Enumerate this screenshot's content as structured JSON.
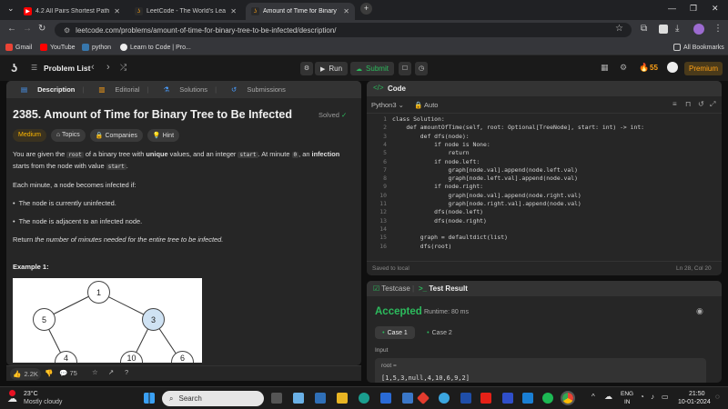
{
  "browser": {
    "tabs": [
      {
        "title": "4.2 All Pairs Shortest Path (Floy",
        "color": "#ff0000"
      },
      {
        "title": "LeetCode - The World's Leading",
        "color": "#ffa116"
      },
      {
        "title": "Amount of Time for Binary Tree",
        "color": "#ffa116"
      }
    ],
    "url": "leetcode.com/problems/amount-of-time-for-binary-tree-to-be-infected/description/",
    "bookmarks": [
      "Gmail",
      "YouTube",
      "python",
      "Learn to Code | Pro..."
    ],
    "all_bookmarks": "All Bookmarks"
  },
  "header": {
    "problem_list": "Problem List",
    "run": "Run",
    "submit": "Submit",
    "streak": "55",
    "premium": "Premium"
  },
  "left": {
    "tabs": [
      "Description",
      "Editorial",
      "Solutions",
      "Submissions"
    ],
    "title": "2385. Amount of Time for Binary Tree to Be Infected",
    "solved": "Solved",
    "difficulty": "Medium",
    "tags": [
      "Topics",
      "Companies",
      "Hint"
    ],
    "desc": {
      "p1a": "You are given the ",
      "p1code1": "root",
      "p1b": " of a binary tree with ",
      "p1bold1": "unique",
      "p1c": " values, and an integer ",
      "p1code2": "start",
      "p1d": ". At minute ",
      "p1code3": "0",
      "p1e": ", an ",
      "p1bold2": "infection",
      "p2a": "starts from the node with value ",
      "p2code": "start",
      "p2b": ".",
      "p3": "Each minute, a node becomes infected if:",
      "bullet1": "The node is currently uninfected.",
      "bullet2": "The node is adjacent to an infected node.",
      "p4a": "Return ",
      "p4em": "the number of minutes needed for the entire tree to be infected."
    },
    "example": "Example 1:",
    "tree_nodes": [
      "1",
      "5",
      "3",
      "4",
      "10",
      "6"
    ],
    "likes": "2.2K",
    "comments": "75"
  },
  "code": {
    "title": "Code",
    "language": "Python3",
    "auto": "Auto",
    "lines": [
      "class Solution:",
      "    def amountOfTime(self, root: Optional[TreeNode], start: int) -> int:",
      "        def dfs(node):",
      "            if node is None:",
      "                return",
      "            if node.left:",
      "                graph[node.val].append(node.left.val)",
      "                graph[node.left.val].append(node.val)",
      "            if node.right:",
      "                graph[node.val].append(node.right.val)",
      "                graph[node.right.val].append(node.val)",
      "            dfs(node.left)",
      "            dfs(node.right)",
      "",
      "        graph = defaultdict(list)",
      "        dfs(root)"
    ],
    "saved": "Saved to local",
    "position": "Ln 28, Col 20"
  },
  "test": {
    "tab1": "Testcase",
    "tab2": "Test Result",
    "status": "Accepted",
    "runtime": "Runtime: 80 ms",
    "case1": "Case 1",
    "case2": "Case 2",
    "input_label": "Input",
    "root_label": "root =",
    "root_value": "[1,5,3,null,4,10,6,9,2]"
  },
  "taskbar": {
    "temp": "23°C",
    "weather": "Mostly cloudy",
    "search": "Search",
    "lang1": "ENG",
    "lang2": "IN",
    "time": "21:50",
    "date": "10-01-2024"
  }
}
